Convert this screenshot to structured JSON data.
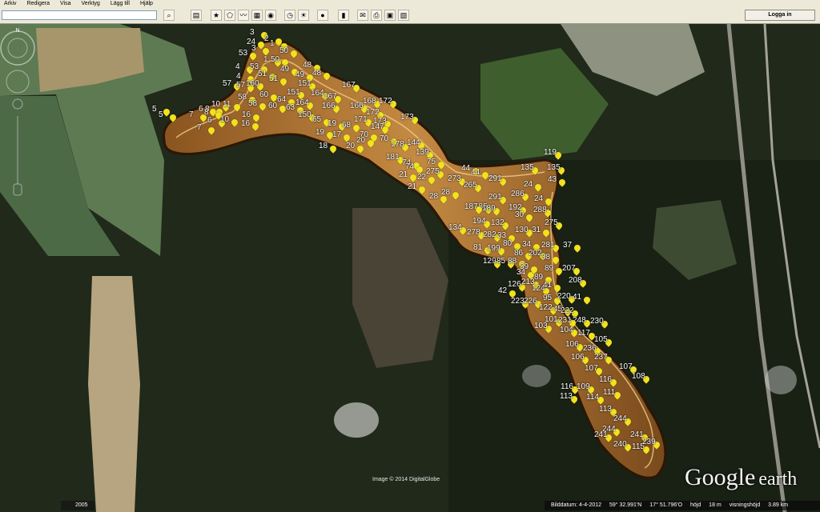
{
  "menu": [
    "Arkiv",
    "Redigera",
    "Visa",
    "Verktyg",
    "Lägg till",
    "Hjälp"
  ],
  "toolbar": {
    "login_label": "Logga in"
  },
  "map": {
    "credit": "Image © 2014 DigitalGlobe",
    "year": "2005",
    "logo_main": "Google",
    "logo_sub": "earth",
    "status": {
      "date": "Bilddatum: 4-4-2012",
      "lat": "59° 32.991'N",
      "lon": "17° 51.796'O",
      "elev_label": "höjd",
      "elev": "18 m",
      "eye_label": "visningshöjd",
      "eye": "3.89 km"
    },
    "markers": [
      {
        "label": "3"
      },
      {
        "label": "2"
      },
      {
        "label": "24"
      },
      {
        "label": "1"
      },
      {
        "label": "53"
      },
      {
        "label": "3"
      },
      {
        "label": "50"
      },
      {
        "label": "1"
      },
      {
        "label": "50"
      },
      {
        "label": "4"
      },
      {
        "label": "53"
      },
      {
        "label": "49"
      },
      {
        "label": "48"
      },
      {
        "label": "4"
      },
      {
        "label": "51"
      },
      {
        "label": "49"
      },
      {
        "label": "48"
      },
      {
        "label": "51"
      },
      {
        "label": "57"
      },
      {
        "label": "57"
      },
      {
        "label": "160"
      },
      {
        "label": "151"
      },
      {
        "label": "167"
      },
      {
        "label": "58"
      },
      {
        "label": "60"
      },
      {
        "label": "151"
      },
      {
        "label": "164"
      },
      {
        "label": "167"
      },
      {
        "label": "5"
      },
      {
        "label": "5"
      },
      {
        "label": "7"
      },
      {
        "label": "6"
      },
      {
        "label": "8"
      },
      {
        "label": "10"
      },
      {
        "label": "11"
      },
      {
        "label": "58"
      },
      {
        "label": "64"
      },
      {
        "label": "164"
      },
      {
        "label": "168"
      },
      {
        "label": "172"
      },
      {
        "label": "16"
      },
      {
        "label": "60"
      },
      {
        "label": "63"
      },
      {
        "label": "166"
      },
      {
        "label": "166"
      },
      {
        "label": "172"
      },
      {
        "label": "7"
      },
      {
        "label": "6"
      },
      {
        "label": "8"
      },
      {
        "label": "10"
      },
      {
        "label": "16"
      },
      {
        "label": "150"
      },
      {
        "label": "65"
      },
      {
        "label": "19"
      },
      {
        "label": "68"
      },
      {
        "label": "171"
      },
      {
        "label": "173"
      },
      {
        "label": "173"
      },
      {
        "label": "19"
      },
      {
        "label": "17"
      },
      {
        "label": "70"
      },
      {
        "label": "147"
      },
      {
        "label": "18"
      },
      {
        "label": "20"
      },
      {
        "label": "20"
      },
      {
        "label": "70"
      },
      {
        "label": "178"
      },
      {
        "label": "144"
      },
      {
        "label": "139"
      },
      {
        "label": "181"
      },
      {
        "label": "74"
      },
      {
        "label": "75"
      },
      {
        "label": "74"
      },
      {
        "label": "44"
      },
      {
        "label": "119"
      },
      {
        "label": "21"
      },
      {
        "label": "22"
      },
      {
        "label": "275"
      },
      {
        "label": "44"
      },
      {
        "label": "135"
      },
      {
        "label": "135"
      },
      {
        "label": "21"
      },
      {
        "label": "273"
      },
      {
        "label": "265"
      },
      {
        "label": "291"
      },
      {
        "label": "43"
      },
      {
        "label": "28"
      },
      {
        "label": "28"
      },
      {
        "label": "185"
      },
      {
        "label": "291"
      },
      {
        "label": "286"
      },
      {
        "label": "24"
      },
      {
        "label": "24"
      },
      {
        "label": "187"
      },
      {
        "label": "189"
      },
      {
        "label": "192"
      },
      {
        "label": "288"
      },
      {
        "label": "134"
      },
      {
        "label": "194"
      },
      {
        "label": "132"
      },
      {
        "label": "30"
      },
      {
        "label": "275"
      },
      {
        "label": "278"
      },
      {
        "label": "282"
      },
      {
        "label": "130"
      },
      {
        "label": "31"
      },
      {
        "label": "33"
      },
      {
        "label": "81"
      },
      {
        "label": "199"
      },
      {
        "label": "80"
      },
      {
        "label": "34"
      },
      {
        "label": "281"
      },
      {
        "label": "37"
      },
      {
        "label": "86"
      },
      {
        "label": "202"
      },
      {
        "label": "129"
      },
      {
        "label": "85"
      },
      {
        "label": "88"
      },
      {
        "label": "34"
      },
      {
        "label": "38"
      },
      {
        "label": "39"
      },
      {
        "label": "89"
      },
      {
        "label": "207"
      },
      {
        "label": "89"
      },
      {
        "label": "208"
      },
      {
        "label": "126"
      },
      {
        "label": "213"
      },
      {
        "label": "124"
      },
      {
        "label": "41"
      },
      {
        "label": "42"
      },
      {
        "label": "95"
      },
      {
        "label": "220"
      },
      {
        "label": "41"
      },
      {
        "label": "223"
      },
      {
        "label": "226"
      },
      {
        "label": "122"
      },
      {
        "label": "45"
      },
      {
        "label": "222"
      },
      {
        "label": "101"
      },
      {
        "label": "103"
      },
      {
        "label": "248"
      },
      {
        "label": "231"
      },
      {
        "label": "230"
      },
      {
        "label": "104"
      },
      {
        "label": "117"
      },
      {
        "label": "105"
      },
      {
        "label": "106"
      },
      {
        "label": "236"
      },
      {
        "label": "106"
      },
      {
        "label": "237"
      },
      {
        "label": "107"
      },
      {
        "label": "107"
      },
      {
        "label": "108"
      },
      {
        "label": "116"
      },
      {
        "label": "116"
      },
      {
        "label": "109"
      },
      {
        "label": "111"
      },
      {
        "label": "113"
      },
      {
        "label": "114"
      },
      {
        "label": "113"
      },
      {
        "label": "244"
      },
      {
        "label": "244"
      },
      {
        "label": "241"
      },
      {
        "label": "241"
      },
      {
        "label": "240"
      },
      {
        "label": "115"
      },
      {
        "label": "239"
      },
      {
        "label": "239"
      }
    ]
  },
  "colors": {
    "ui_bg": "#ece9d8",
    "pin": "#f2e21c",
    "track": "#8a5420",
    "track_light": "#d7a055"
  }
}
